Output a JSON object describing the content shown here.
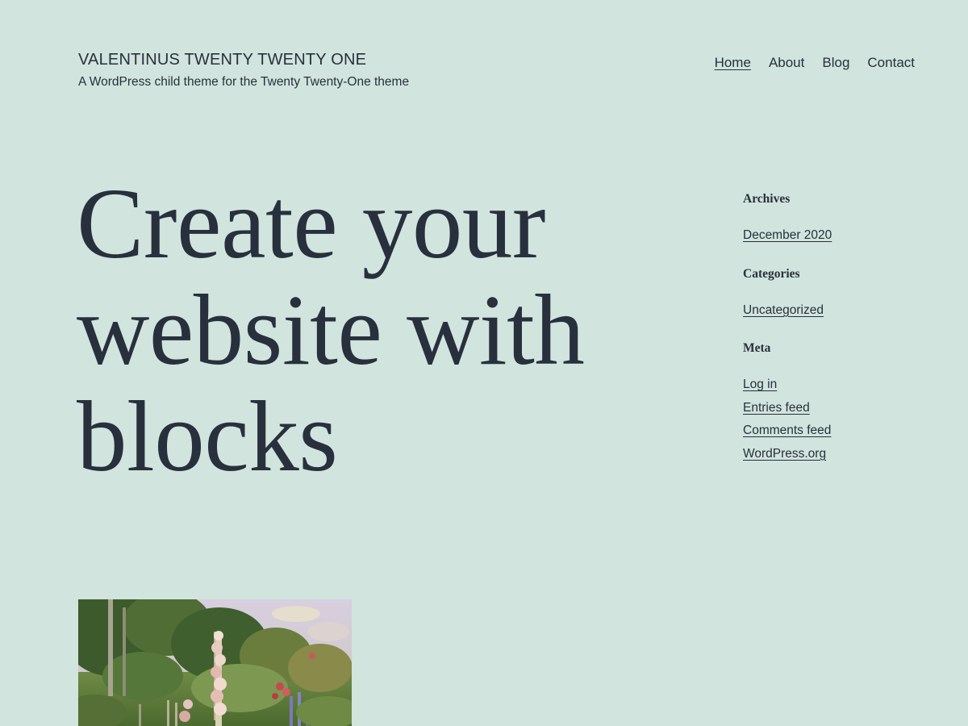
{
  "site": {
    "title": "VALENTINUS TWENTY TWENTY ONE",
    "tagline": "A WordPress child theme for the Twenty Twenty-One theme"
  },
  "nav": {
    "items": [
      {
        "label": "Home",
        "current": true
      },
      {
        "label": "About",
        "current": false
      },
      {
        "label": "Blog",
        "current": false
      },
      {
        "label": "Contact",
        "current": false
      }
    ]
  },
  "hero": {
    "heading": "Create your website with blocks"
  },
  "sidebar": {
    "archives": {
      "title": "Archives",
      "items": [
        "December 2020"
      ]
    },
    "categories": {
      "title": "Categories",
      "items": [
        "Uncategorized"
      ]
    },
    "meta": {
      "title": "Meta",
      "items": [
        "Log in",
        "Entries feed",
        "Comments feed",
        "WordPress.org"
      ]
    }
  },
  "colors": {
    "background": "#d1e4dd",
    "text": "#28303d"
  }
}
